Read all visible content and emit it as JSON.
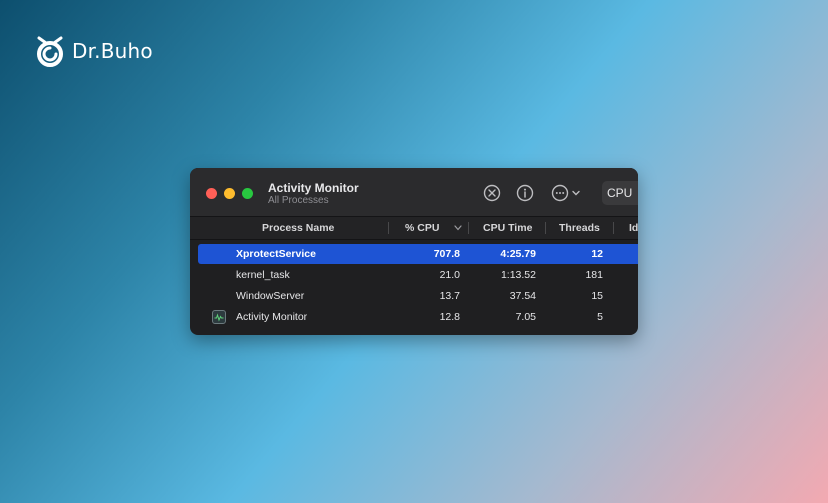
{
  "brand": {
    "name": "Dr.Buho",
    "logo_icon": "buho-logo-icon"
  },
  "window": {
    "title": "Activity Monitor",
    "subtitle": "All Processes",
    "toolbar": {
      "stop_icon": "x-circle-icon",
      "info_icon": "info-icon",
      "more_icon": "ellipsis-circle-icon",
      "tab_cpu": "CPU"
    },
    "columns": [
      "Process Name",
      "% CPU",
      "CPU Time",
      "Threads",
      "Id"
    ],
    "rows": [
      {
        "name": "XprotectService",
        "cpu": "707.8",
        "time": "4:25.79",
        "threads": "12",
        "selected": true
      },
      {
        "name": "kernel_task",
        "cpu": "21.0",
        "time": "1:13.52",
        "threads": "181",
        "selected": false
      },
      {
        "name": "WindowServer",
        "cpu": "13.7",
        "time": "37.54",
        "threads": "15",
        "selected": false
      },
      {
        "name": "Activity Monitor",
        "cpu": "12.8",
        "time": "7.05",
        "threads": "5",
        "selected": false,
        "icon": "activity-monitor-icon"
      }
    ]
  },
  "colors": {
    "traffic_red": "#ff5f57",
    "traffic_yellow": "#febc2e",
    "traffic_green": "#28c840",
    "selection": "#1e54d4"
  }
}
